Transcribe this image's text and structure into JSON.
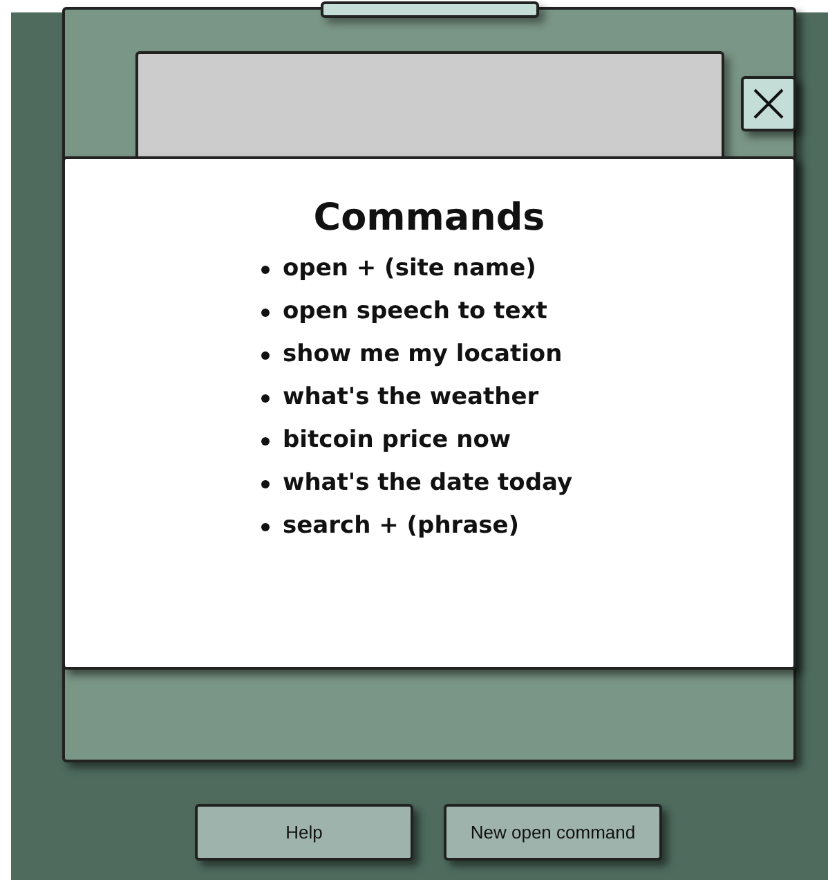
{
  "modal": {
    "title": "Commands",
    "commands": [
      "open + (site name)",
      "open speech to text",
      "show me my location",
      "what's the weather",
      "bitcoin price now",
      "what's the date today",
      "search + (phrase)"
    ]
  },
  "buttons": [
    {
      "label": "Help"
    },
    {
      "label": "New open command"
    }
  ]
}
